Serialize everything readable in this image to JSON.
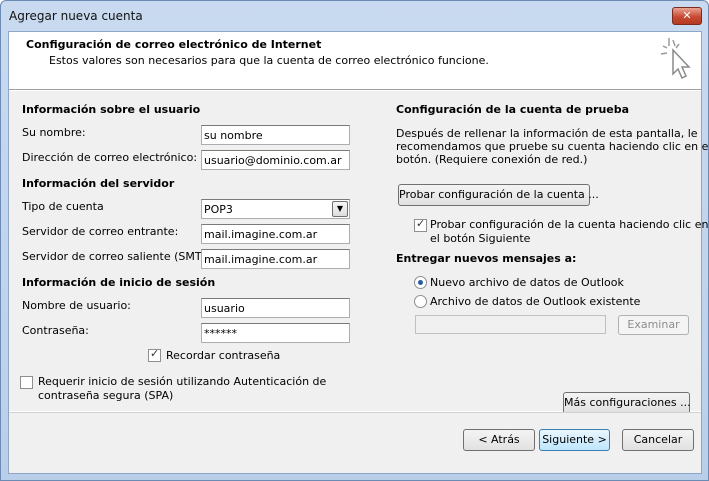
{
  "window": {
    "title": "Agregar nueva cuenta",
    "close_label": "✕"
  },
  "header": {
    "title": "Configuración de correo electrónico de Internet",
    "subtitle": "Estos valores son necesarios para que la cuenta de correo electrónico funcione."
  },
  "user_info": {
    "section_title": "Información sobre el usuario",
    "name_label": "Su nombre:",
    "name_value": "su nombre",
    "email_label": "Dirección de correo electrónico:",
    "email_value": "usuario@dominio.com.ar"
  },
  "server_info": {
    "section_title": "Información del servidor",
    "account_type_label": "Tipo de cuenta",
    "account_type_value": "POP3",
    "incoming_label": "Servidor de correo entrante:",
    "incoming_value": "mail.imagine.com.ar",
    "outgoing_label": "Servidor de correo saliente (SMTP):",
    "outgoing_value": "mail.imagine.com.ar"
  },
  "login_info": {
    "section_title": "Información de inicio de sesión",
    "username_label": "Nombre de usuario:",
    "username_value": "usuario",
    "password_label": "Contraseña:",
    "password_value": "******",
    "remember_label": "Recordar contraseña",
    "remember_checked": true,
    "spa_label_line1": "Requerir inicio de sesión utilizando Autenticación de",
    "spa_label_line2": "contraseña segura (SPA)",
    "spa_checked": false
  },
  "test_settings": {
    "section_title": "Configuración de la cuenta de prueba",
    "description_line1": "Después de rellenar la información de esta pantalla, le",
    "description_line2": "recomendamos que pruebe su cuenta haciendo clic en el",
    "description_line3": "botón. (Requiere conexión de red.)",
    "test_button": "Probar configuración de la cuenta ...",
    "auto_test_line1": "Probar configuración de la cuenta haciendo clic en",
    "auto_test_line2": "el botón Siguiente",
    "auto_test_checked": true
  },
  "deliver": {
    "section_title": "Entregar nuevos mensajes a:",
    "option_new": "Nuevo archivo de datos de Outlook",
    "option_existing": "Archivo de datos de Outlook existente",
    "selected": "new",
    "path_value": "",
    "browse_button": "Examinar"
  },
  "more_settings_button": "Más configuraciones ...",
  "footer": {
    "back_button": "< Atrás",
    "next_button": "Siguiente >",
    "cancel_button": "Cancelar"
  }
}
